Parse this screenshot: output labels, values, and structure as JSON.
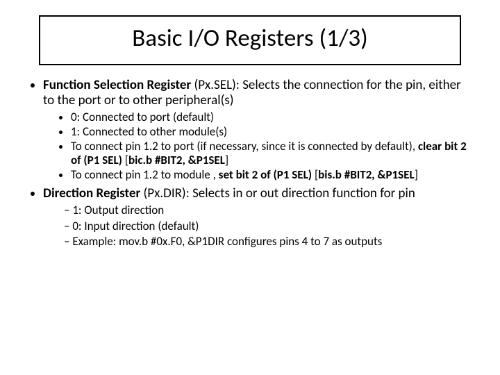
{
  "title": "Basic I/O Registers  (1/3)",
  "item1": {
    "lead_bold": "Function Selection Register ",
    "lead_rest": "(Px.SEL): Selects the connection for the pin, either to the port or to other peripheral(s)",
    "sub1": "0: Connected to port (default)",
    "sub2": "1: Connected to  other module(s)",
    "sub3a": "To connect pin 1.2 to port (if necessary, since it is connected by default), ",
    "sub3b": "clear bit 2 of (P1 SEL)  ",
    "sub3c": "[",
    "sub3d": "bic.b #BIT2, &P1SEL",
    "sub3e": "]",
    "sub4a": "To connect pin 1.2 to module ,  ",
    "sub4b": "set bit 2 of (P1 SEL)  ",
    "sub4c": "[",
    "sub4d": "bis.b #BIT2, &P1SEL",
    "sub4e": "]"
  },
  "item2": {
    "lead_bold": "Direction Register ",
    "lead_rest": "(Px.DIR): Selects in or out direction function for pin",
    "sub1": "1: Output direction",
    "sub2": "0: Input direction (default)",
    "sub3": "Example:  mov.b   #0x.F0, &P1DIR  configures pins 4 to 7 as outputs"
  }
}
